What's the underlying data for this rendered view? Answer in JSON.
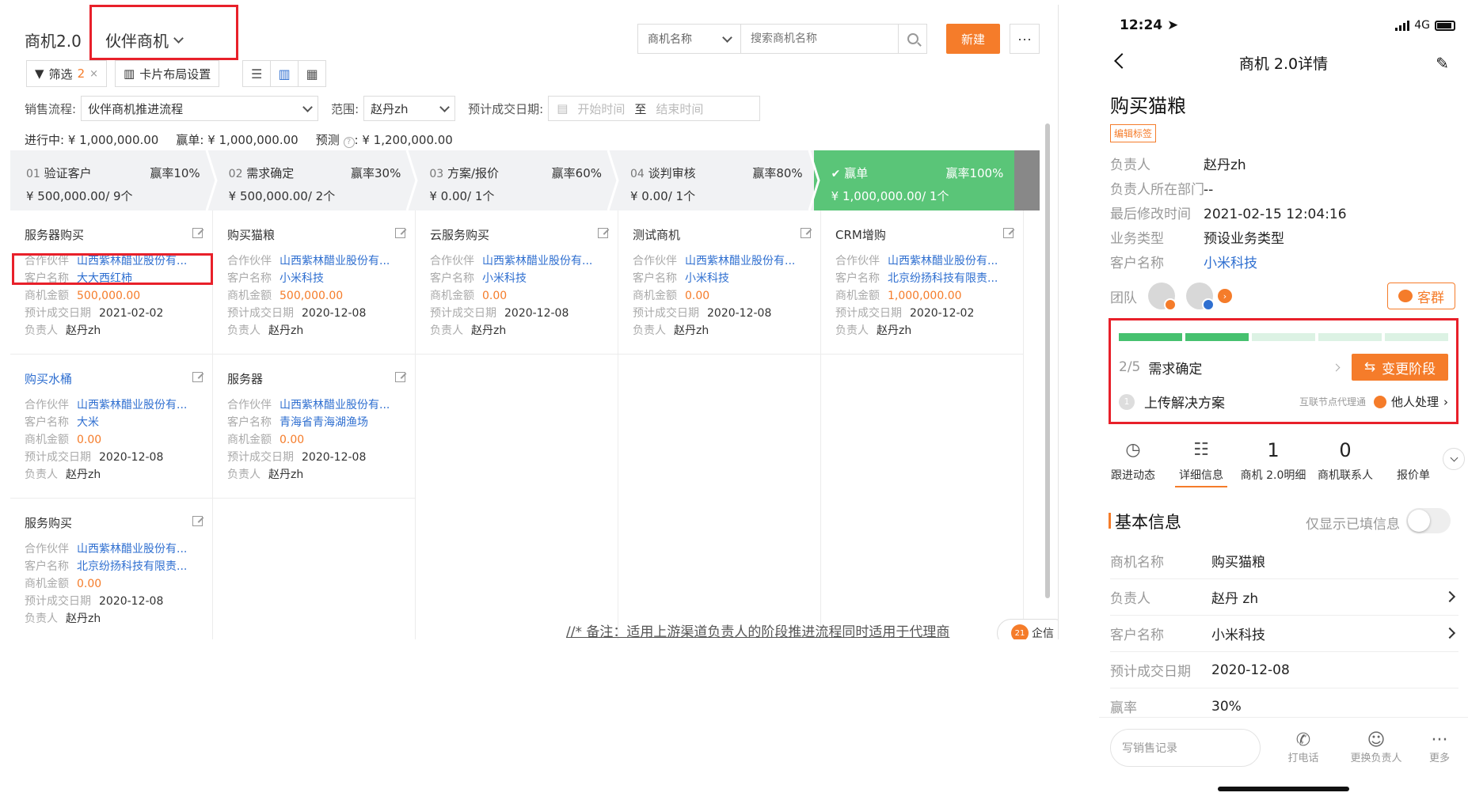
{
  "web": {
    "title": "商机2.0",
    "switcher": "伙伴商机",
    "search": {
      "field": "商机名称",
      "placeholder": "搜索商机名称"
    },
    "new_label": "新建",
    "more_label": "···",
    "toolbar": {
      "filter_label": "筛选",
      "filter_count": "2",
      "filter_clear": "×",
      "layout_label": "卡片布局设置"
    },
    "filters": {
      "process_label": "销售流程:",
      "process_value": "伙伴商机推进流程",
      "scope_label": "范围:",
      "scope_value": "赵丹zh",
      "date_label": "预计成交日期:",
      "start_placeholder": "开始时间",
      "to": "至",
      "end_placeholder": "结束时间"
    },
    "summary": {
      "inprogress_label": "进行中:",
      "inprogress_value": "¥ 1,000,000.00",
      "won_label": "赢单:",
      "won_value": "¥ 1,000,000.00",
      "forecast_label": "预测",
      "forecast_value": ": ¥ 1,200,000.00"
    },
    "stages": [
      {
        "num": "01",
        "name": "验证客户",
        "rate": "赢率10%",
        "amount": "¥ 500,000.00/ 9个"
      },
      {
        "num": "02",
        "name": "需求确定",
        "rate": "赢率30%",
        "amount": "¥ 500,000.00/ 2个"
      },
      {
        "num": "03",
        "name": "方案/报价",
        "rate": "赢率60%",
        "amount": "¥ 0.00/ 1个"
      },
      {
        "num": "04",
        "name": "谈判审核",
        "rate": "赢率80%",
        "amount": "¥ 0.00/ 1个"
      },
      {
        "num": "✔",
        "name": "赢单",
        "rate": "赢率100%",
        "amount": "¥ 1,000,000.00/ 1个"
      }
    ],
    "field_labels": {
      "partner": "合作伙伴",
      "customer": "客户名称",
      "amount": "商机金额",
      "date": "预计成交日期",
      "owner": "负责人"
    },
    "columns": [
      {
        "cards": [
          {
            "title": "服务器购买",
            "partner": "山西紫林醋业股份有...",
            "customer": "大大西红柿",
            "amount": "500,000.00",
            "date": "2021-02-02",
            "owner": "赵丹zh"
          },
          {
            "title": "购买水桶",
            "partner": "山西紫林醋业股份有...",
            "customer": "大米",
            "amount": "0.00",
            "date": "2020-12-08",
            "owner": "赵丹zh"
          },
          {
            "title": "服务购买",
            "partner": "山西紫林醋业股份有...",
            "customer": "北京纷扬科技有限责...",
            "amount": "0.00",
            "date": "2020-12-08",
            "owner": "赵丹zh"
          }
        ]
      },
      {
        "cards": [
          {
            "title": "购买猫粮",
            "partner": "山西紫林醋业股份有...",
            "customer": "小米科技",
            "amount": "500,000.00",
            "date": "2020-12-08",
            "owner": "赵丹zh"
          },
          {
            "title": "服务器",
            "partner": "山西紫林醋业股份有...",
            "customer": "青海省青海湖渔场",
            "amount": "0.00",
            "date": "2020-12-08",
            "owner": "赵丹zh"
          }
        ]
      },
      {
        "cards": [
          {
            "title": "云服务购买",
            "partner": "山西紫林醋业股份有...",
            "customer": "小米科技",
            "amount": "0.00",
            "date": "2020-12-08",
            "owner": "赵丹zh"
          }
        ]
      },
      {
        "cards": [
          {
            "title": "测试商机",
            "partner": "山西紫林醋业股份有...",
            "customer": "小米科技",
            "amount": "0.00",
            "date": "2020-12-08",
            "owner": "赵丹zh"
          }
        ]
      },
      {
        "cards": [
          {
            "title": "CRM增购",
            "partner": "山西紫林醋业股份有...",
            "customer": "北京纷扬科技有限责...",
            "amount": "1,000,000.00",
            "date": "2020-12-02",
            "owner": "赵丹zh"
          }
        ]
      }
    ],
    "note": "//* 备注：适用上游渠道负责人的阶段推进流程同时适用于代理商",
    "qixin": {
      "badge": "21",
      "label": "企信"
    }
  },
  "phone": {
    "time": "12:24",
    "network": "4G",
    "nav_title": "商机 2.0详情",
    "title": "购买猫粮",
    "edit_tag": "编辑标签",
    "info": [
      {
        "k": "负责人",
        "v": "赵丹zh"
      },
      {
        "k": "负责人所在部门",
        "v": "--"
      },
      {
        "k": "最后修改时间",
        "v": "2021-02-15 12:04:16"
      },
      {
        "k": "业务类型",
        "v": "预设业务类型"
      },
      {
        "k": "客户名称",
        "v": "小米科技"
      }
    ],
    "team_label": "团队",
    "kequn_label": "客群",
    "stage": {
      "progress_done": 2,
      "progress_total": 5,
      "fraction": "2/5",
      "name": "需求确定",
      "change_label": "变更阶段",
      "task_num": "1",
      "task_name": "上传解决方案",
      "task_hint": "互联节点代理通",
      "task_other": "他人处理"
    },
    "tabs": [
      {
        "icon": "◷",
        "label": "跟进动态"
      },
      {
        "icon": "☷",
        "label": "详细信息"
      },
      {
        "icon": "1",
        "label": "商机 2.0明细"
      },
      {
        "icon": "0",
        "label": "商机联系人"
      },
      {
        "icon": "",
        "label": "报价单"
      }
    ],
    "section_title": "基本信息",
    "only_filled": "仅显示已填信息",
    "fields": [
      {
        "k": "商机名称",
        "v": "购买猫粮"
      },
      {
        "k": "负责人",
        "v": "赵丹 zh"
      },
      {
        "k": "客户名称",
        "v": "小米科技"
      },
      {
        "k": "预计成交日期",
        "v": "2020-12-08"
      },
      {
        "k": "赢率",
        "v": "30%"
      }
    ],
    "bottom": {
      "compose_placeholder": "写销售记录",
      "call": "打电话",
      "change_owner": "更换负责人",
      "more": "更多"
    }
  }
}
